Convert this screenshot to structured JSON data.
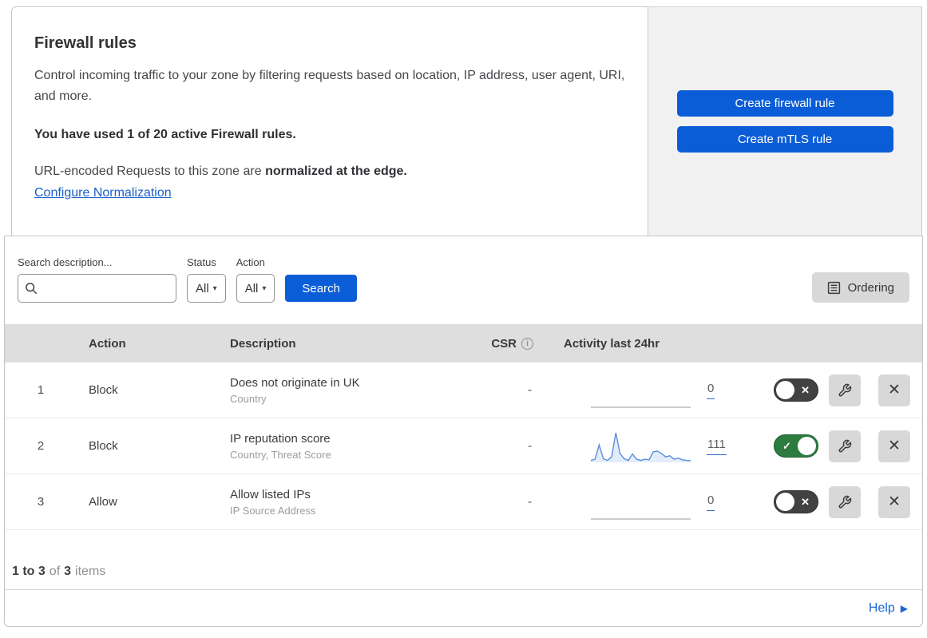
{
  "header": {
    "title": "Firewall rules",
    "description": "Control incoming traffic to your zone by filtering requests based on location, IP address, user agent, URI, and more.",
    "usage": "You have used 1 of 20 active Firewall rules.",
    "normalization_prefix": "URL-encoded Requests to this zone are ",
    "normalization_bold": "normalized at the edge.",
    "normalization_link": "Configure Normalization",
    "create_firewall_button": "Create firewall rule",
    "create_mtls_button": "Create mTLS rule"
  },
  "filters": {
    "search_label": "Search description...",
    "search_value": "",
    "status_label": "Status",
    "status_value": "All",
    "action_label": "Action",
    "action_value": "All",
    "search_button": "Search",
    "ordering_button": "Ordering"
  },
  "table": {
    "columns": {
      "action": "Action",
      "description": "Description",
      "csr": "CSR",
      "activity": "Activity last 24hr"
    },
    "rows": [
      {
        "index": "1",
        "action": "Block",
        "description": "Does not originate in UK",
        "criteria": "Country",
        "csr": "-",
        "activity_count": "0",
        "enabled": false,
        "sparkline": []
      },
      {
        "index": "2",
        "action": "Block",
        "description": "IP reputation score",
        "criteria": "Country, Threat Score",
        "csr": "-",
        "activity_count": "111",
        "enabled": true,
        "sparkline": [
          4,
          8,
          58,
          10,
          4,
          16,
          100,
          28,
          10,
          4,
          26,
          8,
          4,
          8,
          6,
          34,
          36,
          28,
          16,
          20,
          8,
          12,
          6,
          4,
          3
        ]
      },
      {
        "index": "3",
        "action": "Allow",
        "description": "Allow listed IPs",
        "criteria": "IP Source Address",
        "csr": "-",
        "activity_count": "0",
        "enabled": false,
        "sparkline": []
      }
    ]
  },
  "footer": {
    "range": "1 to 3",
    "of": "of",
    "total": "3",
    "items": "items",
    "help": "Help"
  },
  "icons": {
    "check": "✓",
    "x": "✕",
    "caret": "▾",
    "arrow": "▶",
    "info": "i"
  },
  "colors": {
    "accent_blue": "#0b5dd7",
    "toggle_on_green": "#2c7c40",
    "toggle_off_gray": "#424242",
    "sparkline_line": "#5a8fdc",
    "sparkline_fill": "#e3ecf9",
    "link_blue": "#1a5fc8"
  }
}
